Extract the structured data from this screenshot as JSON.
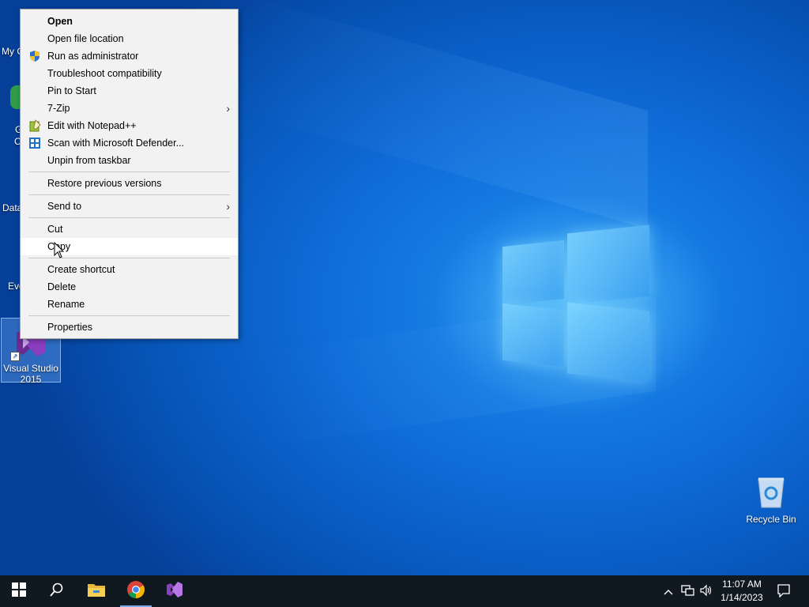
{
  "desktop": {
    "icons": [
      {
        "id": "visual-studio",
        "label_line1": "Visual Studio",
        "label_line2": "2015",
        "icon": "visual-studio-icon"
      },
      {
        "id": "recycle-bin",
        "label": "Recycle Bin",
        "icon": "recycle-bin-icon"
      }
    ],
    "partial_labels": [
      "My C",
      "G",
      "C",
      "Data",
      "Eve"
    ]
  },
  "context_menu": {
    "items": [
      {
        "label": "Open",
        "bold": true
      },
      {
        "label": "Open file location"
      },
      {
        "label": "Run as administrator",
        "icon": "shield-icon"
      },
      {
        "label": "Troubleshoot compatibility"
      },
      {
        "label": "Pin to Start"
      },
      {
        "label": "7-Zip",
        "submenu": true
      },
      {
        "label": "Edit with Notepad++",
        "icon": "notepad-plus-plus-icon"
      },
      {
        "label": "Scan with Microsoft Defender...",
        "icon": "defender-icon"
      },
      {
        "label": "Unpin from taskbar"
      },
      {
        "label": "Restore previous versions"
      },
      {
        "label": "Send to",
        "submenu": true
      },
      {
        "label": "Cut"
      },
      {
        "label": "Copy",
        "highlighted": true
      },
      {
        "label": "Create shortcut"
      },
      {
        "label": "Delete"
      },
      {
        "label": "Rename"
      },
      {
        "label": "Properties"
      }
    ]
  },
  "taskbar": {
    "apps": [
      "start-icon",
      "search-icon",
      "file-explorer-icon",
      "chrome-icon",
      "visual-studio-icon"
    ],
    "active_app": "chrome-icon",
    "clock": {
      "time": "11:07 AM",
      "date": "1/14/2023"
    },
    "tray": [
      "chevron-up-icon",
      "network-icon",
      "volume-icon",
      "notification-icon"
    ]
  },
  "colors": {
    "accent": "#0f6cd9",
    "taskbar": "#101820",
    "menu_bg": "#f2f2f2",
    "highlight": "#ffffff"
  }
}
